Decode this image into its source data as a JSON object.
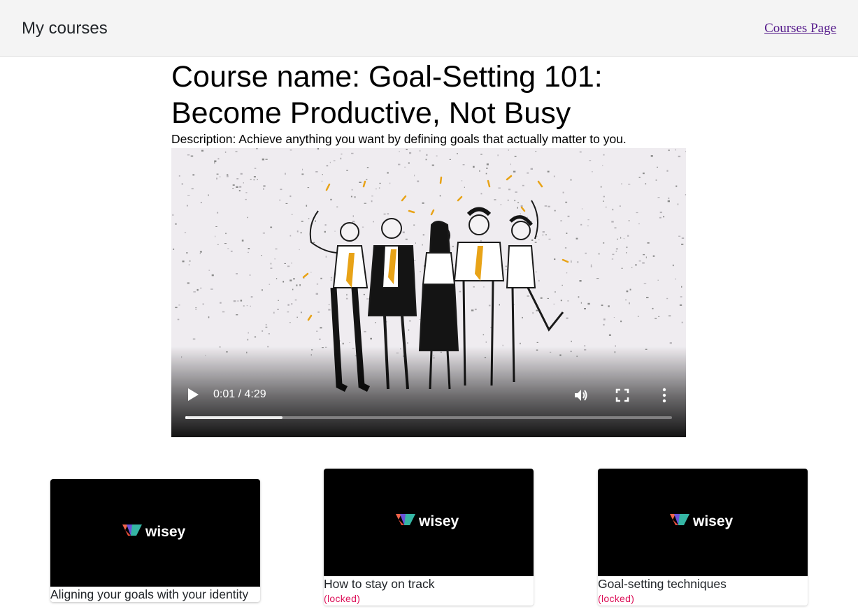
{
  "navbar": {
    "brand": "My courses",
    "link_label": "Courses Page"
  },
  "course": {
    "title": "Course name: Goal-Setting 101: Become Productive, Not Busy",
    "description": "Description: Achieve anything you want by defining goals that actually matter to you."
  },
  "video": {
    "time_label": "0:01 / 4:29",
    "played_fraction": 0.0037,
    "buffered_fraction": 0.2
  },
  "lessons": [
    {
      "title": "Aligning your goals with your identity",
      "status": "",
      "logo_text": "wisey"
    },
    {
      "title": "How to stay on track",
      "status": "(locked)",
      "logo_text": "wisey"
    },
    {
      "title": "Goal-setting techniques",
      "status": "(locked)",
      "logo_text": "wisey"
    }
  ],
  "colors": {
    "navbar_bg": "#f4f4f4",
    "link": "#551a8b",
    "locked": "#dc1058",
    "illustration_accent": "#e8a317"
  }
}
